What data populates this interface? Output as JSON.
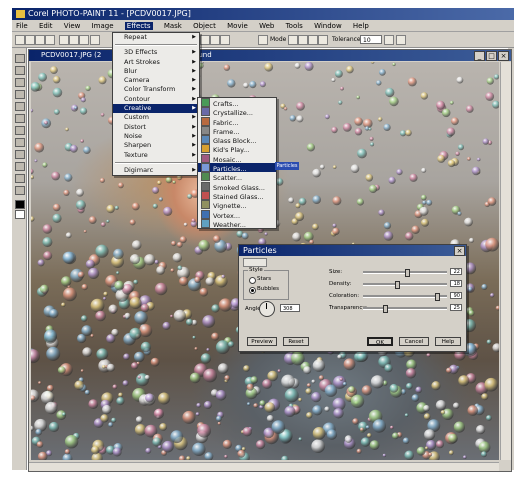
{
  "app": {
    "title": "Corel PHOTO-PAINT 11 - [PCDV0017.JPG]"
  },
  "menubar": {
    "items": [
      "File",
      "Edit",
      "View",
      "Image",
      "Effects",
      "Mask",
      "Object",
      "Movie",
      "Web",
      "Tools",
      "Window",
      "Help"
    ],
    "active_index": 4
  },
  "toolbar": {
    "mode_label": "Mode",
    "tolerance_label": "Tolerance",
    "tolerance_value": "10"
  },
  "document": {
    "title_prefix": "PCDV0017.JPG (2",
    "title_suffix": "ckground"
  },
  "effects_menu": {
    "items": [
      {
        "label": "Repeat",
        "submenu": true
      },
      {
        "separator": true
      },
      {
        "label": "3D Effects",
        "submenu": true
      },
      {
        "label": "Art Strokes",
        "submenu": true
      },
      {
        "label": "Blur",
        "submenu": true
      },
      {
        "label": "Camera",
        "submenu": true
      },
      {
        "label": "Color Transform",
        "submenu": true
      },
      {
        "label": "Contour",
        "submenu": true
      },
      {
        "label": "Creative",
        "submenu": true,
        "selected": true
      },
      {
        "label": "Custom",
        "submenu": true
      },
      {
        "label": "Distort",
        "submenu": true
      },
      {
        "label": "Noise",
        "submenu": true
      },
      {
        "label": "Sharpen",
        "submenu": true
      },
      {
        "label": "Texture",
        "submenu": true
      },
      {
        "separator": true
      },
      {
        "label": "Digimarc",
        "submenu": true
      }
    ]
  },
  "creative_submenu": {
    "items": [
      {
        "label": "Crafts...",
        "icon": "crafts-icon",
        "color": "#4a9a58"
      },
      {
        "label": "Crystallize...",
        "icon": "crystallize-icon",
        "color": "#6a6aa8"
      },
      {
        "label": "Fabric...",
        "icon": "fabric-icon",
        "color": "#b86a40"
      },
      {
        "label": "Frame...",
        "icon": "frame-icon",
        "color": "#888888"
      },
      {
        "label": "Glass Block...",
        "icon": "glass-block-icon",
        "color": "#5a88b8"
      },
      {
        "label": "Kid's Play...",
        "icon": "kids-play-icon",
        "color": "#d8a030"
      },
      {
        "label": "Mosaic...",
        "icon": "mosaic-icon",
        "color": "#a05a80"
      },
      {
        "label": "Particles...",
        "icon": "particles-icon",
        "color": "#7a9ad8",
        "selected": true
      },
      {
        "label": "Scatter...",
        "icon": "scatter-icon",
        "color": "#508a50"
      },
      {
        "label": "Smoked Glass...",
        "icon": "smoked-glass-icon",
        "color": "#6a6a6a"
      },
      {
        "label": "Stained Glass...",
        "icon": "stained-glass-icon",
        "color": "#c05050"
      },
      {
        "label": "Vignette...",
        "icon": "vignette-icon",
        "color": "#909060"
      },
      {
        "label": "Vortex...",
        "icon": "vortex-icon",
        "color": "#4070b0"
      },
      {
        "label": "Weather...",
        "icon": "weather-icon",
        "color": "#60a0c0"
      }
    ]
  },
  "tooltip": {
    "text": "Particles"
  },
  "particles_dialog": {
    "title": "Particles",
    "style_group_label": "Style",
    "style_options": [
      "Stars",
      "Bubbles"
    ],
    "style_selected": "Bubbles",
    "angle_label": "Angle:",
    "angle_value": "308",
    "sliders": [
      {
        "label": "Size:",
        "value": "22",
        "fraction": 0.52
      },
      {
        "label": "Density:",
        "value": "18",
        "fraction": 0.4
      },
      {
        "label": "Coloration:",
        "value": "90",
        "fraction": 0.9
      },
      {
        "label": "Transparency:",
        "value": "25",
        "fraction": 0.25
      }
    ],
    "buttons": {
      "preview": "Preview",
      "reset": "Reset",
      "ok": "OK",
      "cancel": "Cancel",
      "help": "Help"
    }
  },
  "colors": {
    "title_bar": "#0a246a",
    "highlight": "#0a246a",
    "chrome": "#d4d0c8"
  }
}
